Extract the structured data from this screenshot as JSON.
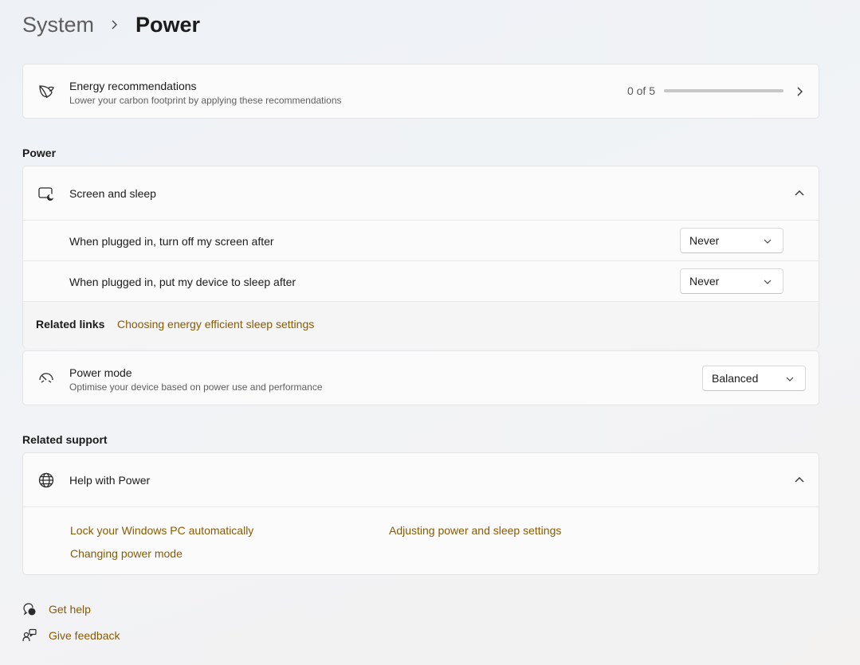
{
  "breadcrumb": {
    "parent": "System",
    "current": "Power"
  },
  "energy": {
    "title": "Energy recommendations",
    "subtitle": "Lower your carbon footprint by applying these recommendations",
    "progress_text": "0 of 5",
    "progress_fraction": 0,
    "icon": "leaf-icon"
  },
  "power_section": {
    "label": "Power",
    "screen_sleep": {
      "title": "Screen and sleep",
      "icon": "screen-sleep-icon",
      "rows": [
        {
          "label": "When plugged in, turn off my screen after",
          "value": "Never"
        },
        {
          "label": "When plugged in, put my device to sleep after",
          "value": "Never"
        }
      ],
      "related_links_label": "Related links",
      "related_link": "Choosing energy efficient sleep settings"
    },
    "power_mode": {
      "title": "Power mode",
      "subtitle": "Optimise your device based on power use and performance",
      "value": "Balanced",
      "icon": "gauge-icon"
    }
  },
  "support_section": {
    "label": "Related support",
    "help": {
      "title": "Help with Power",
      "icon": "globe-icon",
      "links": [
        "Lock your Windows PC automatically",
        "Adjusting power and sleep settings",
        "Changing power mode"
      ]
    }
  },
  "footer": {
    "get_help": "Get help",
    "give_feedback": "Give feedback"
  },
  "colors": {
    "accent": "#8a5a00",
    "card": "#fbfbfb",
    "border": "#e3e3e3"
  }
}
